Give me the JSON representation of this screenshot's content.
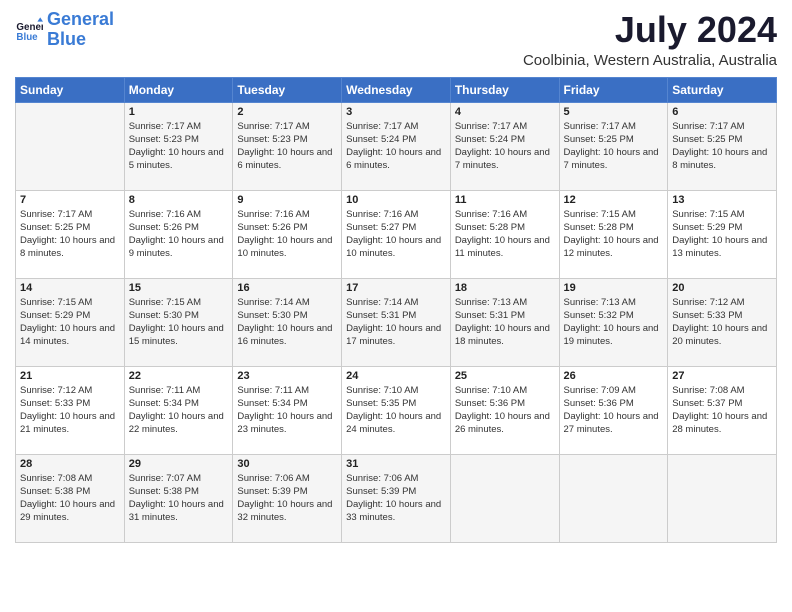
{
  "logo": {
    "text_general": "General",
    "text_blue": "Blue"
  },
  "title": {
    "month_year": "July 2024",
    "location": "Coolbinia, Western Australia, Australia"
  },
  "days_header": [
    "Sunday",
    "Monday",
    "Tuesday",
    "Wednesday",
    "Thursday",
    "Friday",
    "Saturday"
  ],
  "weeks": [
    [
      {
        "day": "",
        "sunrise": "",
        "sunset": "",
        "daylight": ""
      },
      {
        "day": "1",
        "sunrise": "Sunrise: 7:17 AM",
        "sunset": "Sunset: 5:23 PM",
        "daylight": "Daylight: 10 hours and 5 minutes."
      },
      {
        "day": "2",
        "sunrise": "Sunrise: 7:17 AM",
        "sunset": "Sunset: 5:23 PM",
        "daylight": "Daylight: 10 hours and 6 minutes."
      },
      {
        "day": "3",
        "sunrise": "Sunrise: 7:17 AM",
        "sunset": "Sunset: 5:24 PM",
        "daylight": "Daylight: 10 hours and 6 minutes."
      },
      {
        "day": "4",
        "sunrise": "Sunrise: 7:17 AM",
        "sunset": "Sunset: 5:24 PM",
        "daylight": "Daylight: 10 hours and 7 minutes."
      },
      {
        "day": "5",
        "sunrise": "Sunrise: 7:17 AM",
        "sunset": "Sunset: 5:25 PM",
        "daylight": "Daylight: 10 hours and 7 minutes."
      },
      {
        "day": "6",
        "sunrise": "Sunrise: 7:17 AM",
        "sunset": "Sunset: 5:25 PM",
        "daylight": "Daylight: 10 hours and 8 minutes."
      }
    ],
    [
      {
        "day": "7",
        "sunrise": "Sunrise: 7:17 AM",
        "sunset": "Sunset: 5:25 PM",
        "daylight": "Daylight: 10 hours and 8 minutes."
      },
      {
        "day": "8",
        "sunrise": "Sunrise: 7:16 AM",
        "sunset": "Sunset: 5:26 PM",
        "daylight": "Daylight: 10 hours and 9 minutes."
      },
      {
        "day": "9",
        "sunrise": "Sunrise: 7:16 AM",
        "sunset": "Sunset: 5:26 PM",
        "daylight": "Daylight: 10 hours and 10 minutes."
      },
      {
        "day": "10",
        "sunrise": "Sunrise: 7:16 AM",
        "sunset": "Sunset: 5:27 PM",
        "daylight": "Daylight: 10 hours and 10 minutes."
      },
      {
        "day": "11",
        "sunrise": "Sunrise: 7:16 AM",
        "sunset": "Sunset: 5:28 PM",
        "daylight": "Daylight: 10 hours and 11 minutes."
      },
      {
        "day": "12",
        "sunrise": "Sunrise: 7:15 AM",
        "sunset": "Sunset: 5:28 PM",
        "daylight": "Daylight: 10 hours and 12 minutes."
      },
      {
        "day": "13",
        "sunrise": "Sunrise: 7:15 AM",
        "sunset": "Sunset: 5:29 PM",
        "daylight": "Daylight: 10 hours and 13 minutes."
      }
    ],
    [
      {
        "day": "14",
        "sunrise": "Sunrise: 7:15 AM",
        "sunset": "Sunset: 5:29 PM",
        "daylight": "Daylight: 10 hours and 14 minutes."
      },
      {
        "day": "15",
        "sunrise": "Sunrise: 7:15 AM",
        "sunset": "Sunset: 5:30 PM",
        "daylight": "Daylight: 10 hours and 15 minutes."
      },
      {
        "day": "16",
        "sunrise": "Sunrise: 7:14 AM",
        "sunset": "Sunset: 5:30 PM",
        "daylight": "Daylight: 10 hours and 16 minutes."
      },
      {
        "day": "17",
        "sunrise": "Sunrise: 7:14 AM",
        "sunset": "Sunset: 5:31 PM",
        "daylight": "Daylight: 10 hours and 17 minutes."
      },
      {
        "day": "18",
        "sunrise": "Sunrise: 7:13 AM",
        "sunset": "Sunset: 5:31 PM",
        "daylight": "Daylight: 10 hours and 18 minutes."
      },
      {
        "day": "19",
        "sunrise": "Sunrise: 7:13 AM",
        "sunset": "Sunset: 5:32 PM",
        "daylight": "Daylight: 10 hours and 19 minutes."
      },
      {
        "day": "20",
        "sunrise": "Sunrise: 7:12 AM",
        "sunset": "Sunset: 5:33 PM",
        "daylight": "Daylight: 10 hours and 20 minutes."
      }
    ],
    [
      {
        "day": "21",
        "sunrise": "Sunrise: 7:12 AM",
        "sunset": "Sunset: 5:33 PM",
        "daylight": "Daylight: 10 hours and 21 minutes."
      },
      {
        "day": "22",
        "sunrise": "Sunrise: 7:11 AM",
        "sunset": "Sunset: 5:34 PM",
        "daylight": "Daylight: 10 hours and 22 minutes."
      },
      {
        "day": "23",
        "sunrise": "Sunrise: 7:11 AM",
        "sunset": "Sunset: 5:34 PM",
        "daylight": "Daylight: 10 hours and 23 minutes."
      },
      {
        "day": "24",
        "sunrise": "Sunrise: 7:10 AM",
        "sunset": "Sunset: 5:35 PM",
        "daylight": "Daylight: 10 hours and 24 minutes."
      },
      {
        "day": "25",
        "sunrise": "Sunrise: 7:10 AM",
        "sunset": "Sunset: 5:36 PM",
        "daylight": "Daylight: 10 hours and 26 minutes."
      },
      {
        "day": "26",
        "sunrise": "Sunrise: 7:09 AM",
        "sunset": "Sunset: 5:36 PM",
        "daylight": "Daylight: 10 hours and 27 minutes."
      },
      {
        "day": "27",
        "sunrise": "Sunrise: 7:08 AM",
        "sunset": "Sunset: 5:37 PM",
        "daylight": "Daylight: 10 hours and 28 minutes."
      }
    ],
    [
      {
        "day": "28",
        "sunrise": "Sunrise: 7:08 AM",
        "sunset": "Sunset: 5:38 PM",
        "daylight": "Daylight: 10 hours and 29 minutes."
      },
      {
        "day": "29",
        "sunrise": "Sunrise: 7:07 AM",
        "sunset": "Sunset: 5:38 PM",
        "daylight": "Daylight: 10 hours and 31 minutes."
      },
      {
        "day": "30",
        "sunrise": "Sunrise: 7:06 AM",
        "sunset": "Sunset: 5:39 PM",
        "daylight": "Daylight: 10 hours and 32 minutes."
      },
      {
        "day": "31",
        "sunrise": "Sunrise: 7:06 AM",
        "sunset": "Sunset: 5:39 PM",
        "daylight": "Daylight: 10 hours and 33 minutes."
      },
      {
        "day": "",
        "sunrise": "",
        "sunset": "",
        "daylight": ""
      },
      {
        "day": "",
        "sunrise": "",
        "sunset": "",
        "daylight": ""
      },
      {
        "day": "",
        "sunrise": "",
        "sunset": "",
        "daylight": ""
      }
    ]
  ]
}
